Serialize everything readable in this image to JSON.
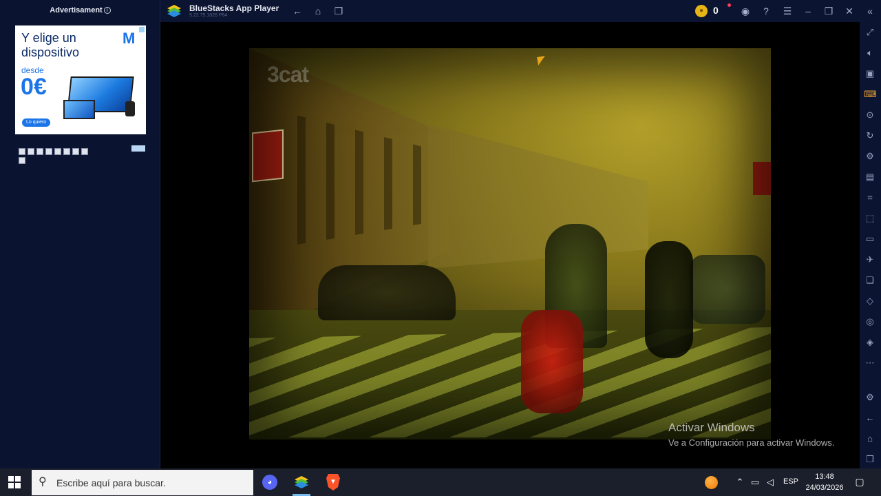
{
  "sidebar_ad": {
    "label": "Advertisament",
    "info_glyph": "i",
    "headline": "Y elige un dispositivo",
    "from_text": "desde",
    "price": "0€",
    "cta": "Lo quiero",
    "brand_color": "#1b74e8"
  },
  "window": {
    "title": "BlueStacks App Player",
    "version": "5.22.75.1026 P64",
    "coin_count": "0",
    "icons": {
      "back": "back-arrow-icon",
      "home": "home-icon",
      "multi": "multi-instance-icon",
      "account": "account-icon",
      "help": "help-icon",
      "menu": "menu-icon",
      "minimize": "minimize-icon",
      "restore": "restore-icon",
      "close": "close-icon",
      "collapse": "collapse-sidebar-icon"
    }
  },
  "video": {
    "watermark": "3cat"
  },
  "activation": {
    "title": "Activar Windows",
    "subtitle": "Ve a Configuración para activar Windows."
  },
  "right_toolbar": {
    "icons": [
      "fullscreen-icon",
      "volume-icon",
      "media-icon",
      "keyboard-icon",
      "record-icon",
      "rotate-icon",
      "macro-icon",
      "apk-icon",
      "screenshot-icon",
      "resize-icon",
      "folder-icon",
      "airplane-icon",
      "multi-window-icon",
      "eco-mode-icon",
      "location-icon",
      "layers-icon",
      "more-icon",
      "settings-icon",
      "back-icon",
      "home-icon",
      "recents-icon"
    ]
  },
  "taskbar": {
    "search_placeholder": "Escribe aquí para buscar.",
    "language": "ESP",
    "time": "13:48",
    "date": "24/03/2026",
    "apps": [
      "discord",
      "bluestacks",
      "brave"
    ]
  }
}
